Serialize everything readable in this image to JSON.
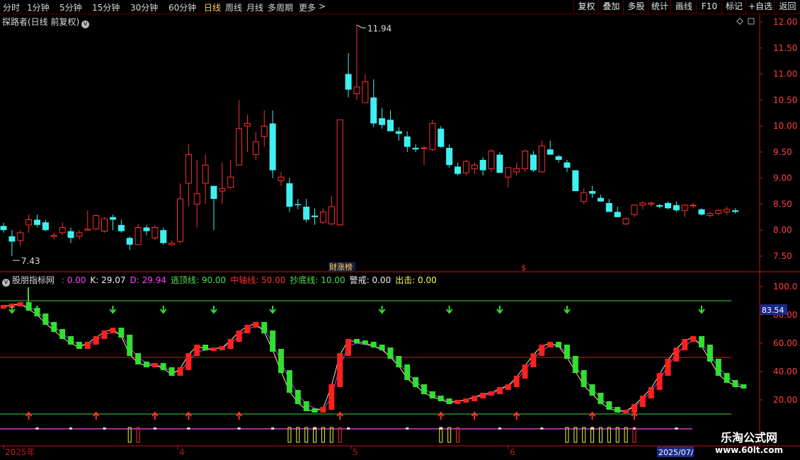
{
  "toolbar": {
    "periods": [
      "分时",
      "1分钟",
      "5分钟",
      "15分钟",
      "30分钟",
      "60分钟",
      "日线",
      "周线",
      "月线",
      "多周期",
      "更多"
    ],
    "active_period": "日线",
    "more_arrow": ">",
    "right_buttons": [
      "复权",
      "叠加",
      "多股",
      "统计",
      "画线",
      "F10",
      "标记",
      "+自选",
      "返回"
    ]
  },
  "main_chart": {
    "title": "探路者(日线 前复权)",
    "title_pill": "v",
    "price_axis": [
      "12.00",
      "11.50",
      "11.00",
      "10.50",
      "10.00",
      "9.50",
      "9.00",
      "8.50",
      "8.00",
      "7.50"
    ],
    "high_label": "11.94",
    "low_label": "7.43",
    "badge": "财涨榜",
    "marker": "$",
    "colors": {
      "up": "#ff3030",
      "down": "#40f0f0",
      "axis": "#c01818",
      "price_text": "#ff4040"
    }
  },
  "indicator": {
    "name": "股朋指标网",
    "items": [
      {
        "label": ": 0.00",
        "color": "#ff40ff"
      },
      {
        "label": "K: 29.07",
        "color": "#f0f0f0"
      },
      {
        "label": "D: 29.94",
        "color": "#ff40ff"
      },
      {
        "label": "逃顶线: 90.00",
        "color": "#50e050"
      },
      {
        "label": "中轴线: 50.00",
        "color": "#ff3030"
      },
      {
        "label": "抄底线: 10.00",
        "color": "#50e050"
      },
      {
        "label": "警戒: 0.00",
        "color": "#f0f0f0"
      },
      {
        "label": "出击: 0.00",
        "color": "#ffff40"
      }
    ],
    "axis": [
      "100.0",
      "80.00",
      "60.00",
      "40.00",
      "20.00"
    ],
    "current_value": "83.54"
  },
  "date_axis": {
    "labels": [
      "2025年",
      "4",
      "5",
      "6"
    ],
    "highlight": "2025/07/"
  },
  "watermark": {
    "line1": "乐淘公式网",
    "line2": "www.60lt.com"
  },
  "chart_data": {
    "type": "candlestick",
    "ylim": [
      7.2,
      12.15
    ],
    "ohlc": [
      [
        8.08,
        8.14,
        7.95,
        8.0
      ],
      [
        7.88,
        8.0,
        7.5,
        7.78
      ],
      [
        7.8,
        8.0,
        7.7,
        7.95
      ],
      [
        8.1,
        8.3,
        7.95,
        8.2
      ],
      [
        8.2,
        8.3,
        8.05,
        8.1
      ],
      [
        8.15,
        8.2,
        7.98,
        8.0
      ],
      [
        7.88,
        7.95,
        7.82,
        7.9
      ],
      [
        7.95,
        8.15,
        7.9,
        8.05
      ],
      [
        7.98,
        8.05,
        7.75,
        7.85
      ],
      [
        7.88,
        8.0,
        7.82,
        7.95
      ],
      [
        8.0,
        8.38,
        8.0,
        8.02
      ],
      [
        8.02,
        8.3,
        8.0,
        8.28
      ],
      [
        7.98,
        8.25,
        7.95,
        8.22
      ],
      [
        8.25,
        8.3,
        8.0,
        8.2
      ],
      [
        8.1,
        8.2,
        7.95,
        7.98
      ],
      [
        7.85,
        7.88,
        7.62,
        7.72
      ],
      [
        7.72,
        8.12,
        7.72,
        8.05
      ],
      [
        8.05,
        8.1,
        7.9,
        7.98
      ],
      [
        7.85,
        8.1,
        7.82,
        8.05
      ],
      [
        8.0,
        8.05,
        7.72,
        7.75
      ],
      [
        7.72,
        7.8,
        7.7,
        7.75
      ],
      [
        7.78,
        8.9,
        7.75,
        8.6
      ],
      [
        8.9,
        9.65,
        8.45,
        9.45
      ],
      [
        8.5,
        9.35,
        8.05,
        8.7
      ],
      [
        8.9,
        9.45,
        8.5,
        9.25
      ],
      [
        8.85,
        8.85,
        8.0,
        8.6
      ],
      [
        8.75,
        9.3,
        8.5,
        8.8
      ],
      [
        8.82,
        9.35,
        8.8,
        9.02
      ],
      [
        9.25,
        10.5,
        9.4,
        9.95
      ],
      [
        10.0,
        10.22,
        9.5,
        10.05
      ],
      [
        9.45,
        9.88,
        9.35,
        9.7
      ],
      [
        9.8,
        10.3,
        9.6,
        10.0
      ],
      [
        10.05,
        10.3,
        9.0,
        9.15
      ],
      [
        8.95,
        9.12,
        8.85,
        9.02
      ],
      [
        8.9,
        9.0,
        8.35,
        8.45
      ],
      [
        8.5,
        8.6,
        8.4,
        8.48
      ],
      [
        8.45,
        8.6,
        8.15,
        8.2
      ],
      [
        8.28,
        8.42,
        8.1,
        8.25
      ],
      [
        8.15,
        8.42,
        8.12,
        8.35
      ],
      [
        8.12,
        8.65,
        8.1,
        8.45
      ],
      [
        8.1,
        10.12,
        8.08,
        10.12
      ],
      [
        11.0,
        11.4,
        10.55,
        10.7
      ],
      [
        10.62,
        11.94,
        10.5,
        10.75
      ],
      [
        10.45,
        11.0,
        10.5,
        10.85
      ],
      [
        10.55,
        10.9,
        9.98,
        10.05
      ],
      [
        10.15,
        10.35,
        9.95,
        10.02
      ],
      [
        10.12,
        10.3,
        9.92,
        9.9
      ],
      [
        9.9,
        9.98,
        9.72,
        9.85
      ],
      [
        9.8,
        9.9,
        9.5,
        9.6
      ],
      [
        9.58,
        9.65,
        9.5,
        9.55
      ],
      [
        9.57,
        9.62,
        9.25,
        9.58
      ],
      [
        9.55,
        10.12,
        9.52,
        10.05
      ],
      [
        9.95,
        10.0,
        9.58,
        9.6
      ],
      [
        9.58,
        9.65,
        9.2,
        9.25
      ],
      [
        9.22,
        9.3,
        9.05,
        9.08
      ],
      [
        9.1,
        9.35,
        9.05,
        9.32
      ],
      [
        9.18,
        9.3,
        9.08,
        9.25
      ],
      [
        9.35,
        9.4,
        9.05,
        9.15
      ],
      [
        9.18,
        9.55,
        9.12,
        9.52
      ],
      [
        9.45,
        9.5,
        9.1,
        9.1
      ],
      [
        9.02,
        9.2,
        8.82,
        9.2
      ],
      [
        9.12,
        9.3,
        9.05,
        9.18
      ],
      [
        9.18,
        9.55,
        9.12,
        9.52
      ],
      [
        9.45,
        9.52,
        9.12,
        9.15
      ],
      [
        9.12,
        9.72,
        9.1,
        9.62
      ],
      [
        9.55,
        9.72,
        9.45,
        9.45
      ],
      [
        9.42,
        9.45,
        9.3,
        9.35
      ],
      [
        9.3,
        9.35,
        9.12,
        9.2
      ],
      [
        9.15,
        9.15,
        8.75,
        8.75
      ],
      [
        8.55,
        8.8,
        8.5,
        8.72
      ],
      [
        8.75,
        8.85,
        8.62,
        8.7
      ],
      [
        8.62,
        8.68,
        8.55,
        8.55
      ],
      [
        8.52,
        8.6,
        8.35,
        8.35
      ],
      [
        8.35,
        8.45,
        8.25,
        8.25
      ],
      [
        8.12,
        8.25,
        8.1,
        8.22
      ],
      [
        8.3,
        8.5,
        8.25,
        8.48
      ],
      [
        8.48,
        8.55,
        8.4,
        8.52
      ],
      [
        8.5,
        8.55,
        8.45,
        8.52
      ],
      [
        8.48,
        8.5,
        8.42,
        8.45
      ],
      [
        8.52,
        8.55,
        8.4,
        8.42
      ],
      [
        8.48,
        8.55,
        8.35,
        8.38
      ],
      [
        8.38,
        8.5,
        8.25,
        8.48
      ],
      [
        8.48,
        8.52,
        8.42,
        8.48
      ],
      [
        8.4,
        8.42,
        8.28,
        8.3
      ],
      [
        8.28,
        8.35,
        8.25,
        8.32
      ],
      [
        8.32,
        8.4,
        8.28,
        8.38
      ],
      [
        8.35,
        8.45,
        8.3,
        8.4
      ],
      [
        8.38,
        8.42,
        8.32,
        8.35
      ]
    ],
    "kdj_k": [
      86,
      87,
      88,
      84,
      80,
      74,
      69,
      64,
      60,
      57,
      60,
      64,
      68,
      70,
      65,
      52,
      46,
      44,
      45,
      42,
      38,
      42,
      52,
      58,
      56,
      56,
      57,
      62,
      68,
      72,
      74,
      68,
      55,
      40,
      26,
      18,
      13,
      12,
      14,
      30,
      52,
      62,
      61,
      60,
      58,
      56,
      50,
      44,
      35,
      30,
      25,
      22,
      20,
      18,
      19,
      20,
      22,
      24,
      25,
      28,
      30,
      36,
      44,
      52,
      58,
      60,
      58,
      50,
      40,
      30,
      24,
      18,
      14,
      12,
      12,
      16,
      22,
      28,
      38,
      48,
      56,
      62,
      64,
      58,
      48,
      38,
      33,
      30,
      29
    ],
    "kdj_d": [
      86,
      87,
      87,
      86,
      82,
      77,
      72,
      67,
      62,
      59,
      59,
      62,
      66,
      68,
      66,
      57,
      50,
      46,
      45,
      43,
      40,
      40,
      47,
      54,
      55,
      56,
      57,
      60,
      65,
      70,
      72,
      70,
      60,
      47,
      34,
      24,
      17,
      14,
      13,
      22,
      44,
      58,
      60,
      59,
      58,
      55,
      51,
      46,
      39,
      33,
      28,
      24,
      21,
      19,
      19,
      20,
      22,
      23,
      24,
      27,
      30,
      34,
      41,
      49,
      55,
      58,
      58,
      53,
      44,
      35,
      28,
      21,
      16,
      13,
      12,
      15,
      20,
      26,
      34,
      44,
      52,
      58,
      62,
      60,
      52,
      43,
      37,
      32,
      30
    ],
    "levels": {
      "top": 90,
      "mid": 50,
      "bottom": 10
    }
  }
}
